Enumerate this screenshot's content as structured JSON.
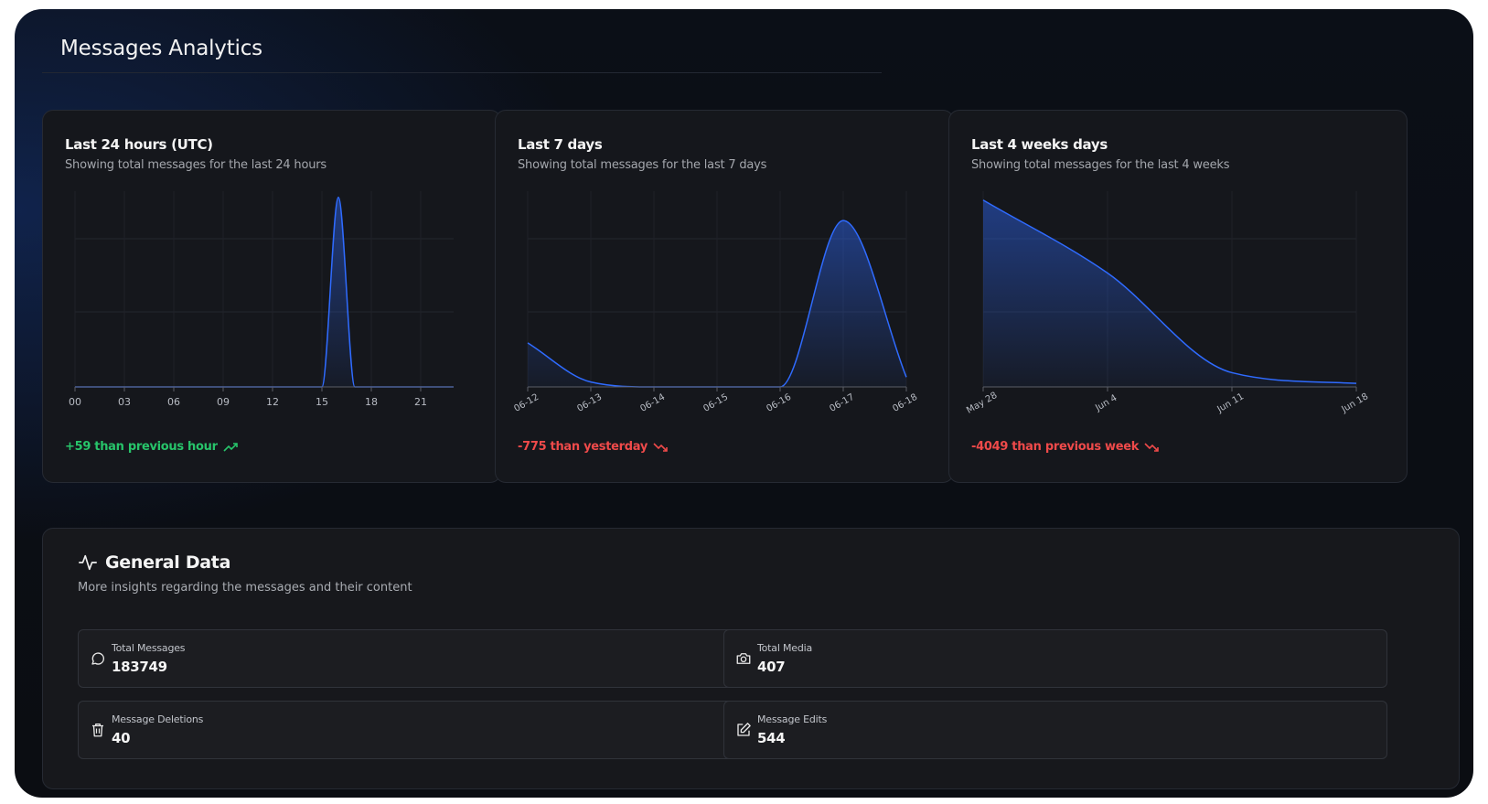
{
  "page": {
    "title": "Messages Analytics"
  },
  "cards": [
    {
      "title": "Last 24 hours (UTC)",
      "subtitle": "Showing total messages for the last 24 hours",
      "trend": "+59 than previous hour",
      "trend_dir": "up",
      "ticks": [
        "00",
        "03",
        "06",
        "09",
        "12",
        "15",
        "18",
        "21"
      ]
    },
    {
      "title": "Last 7 days",
      "subtitle": "Showing total messages for the last 7 days",
      "trend": "-775 than yesterday",
      "trend_dir": "down",
      "ticks": [
        "06-12",
        "06-13",
        "06-14",
        "06-15",
        "06-16",
        "06-17",
        "06-18"
      ]
    },
    {
      "title": "Last 4 weeks days",
      "subtitle": "Showing total messages for the last 4 weeks",
      "trend": "-4049 than previous week",
      "trend_dir": "down",
      "ticks": [
        "May 28",
        "Jun 4",
        "Jun 11",
        "Jun 18"
      ]
    }
  ],
  "chart_data": [
    {
      "type": "area",
      "x": [
        "00",
        "01",
        "02",
        "03",
        "04",
        "05",
        "06",
        "07",
        "08",
        "09",
        "10",
        "11",
        "12",
        "13",
        "14",
        "15",
        "16",
        "17",
        "18",
        "19",
        "20",
        "21",
        "22",
        "23"
      ],
      "values": [
        0,
        0,
        0,
        0,
        0,
        0,
        0,
        0,
        0,
        0,
        0,
        0,
        0,
        0,
        0,
        0,
        775,
        0,
        0,
        0,
        0,
        0,
        0,
        0
      ],
      "color": "#2f6bff"
    },
    {
      "type": "area",
      "x": [
        "06-12",
        "06-13",
        "06-14",
        "06-15",
        "06-16",
        "06-17",
        "06-18"
      ],
      "values": [
        180,
        20,
        0,
        0,
        0,
        680,
        40
      ],
      "color": "#2f6bff"
    },
    {
      "type": "area",
      "x": [
        "May 28",
        "Jun 4",
        "Jun 11",
        "Jun 18"
      ],
      "values": [
        5250,
        3200,
        400,
        100
      ],
      "color": "#2f6bff"
    }
  ],
  "general": {
    "title": "General Data",
    "subtitle": "More insights regarding the messages and their content",
    "stats": [
      {
        "label": "Total Messages",
        "value": "183749",
        "icon": "message-circle-icon"
      },
      {
        "label": "Total Media",
        "value": "407",
        "icon": "camera-icon"
      },
      {
        "label": "Message Deletions",
        "value": "40",
        "icon": "trash-icon"
      },
      {
        "label": "Message Edits",
        "value": "544",
        "icon": "edit-icon"
      }
    ]
  }
}
